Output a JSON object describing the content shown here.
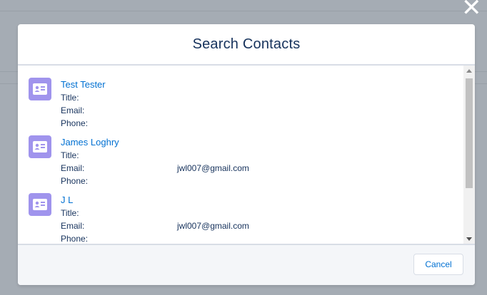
{
  "close_icon_glyph": "✕",
  "modal": {
    "title": "Search Contacts",
    "cancel_label": "Cancel"
  },
  "field_labels": {
    "title": "Title:",
    "email": "Email:",
    "phone": "Phone:"
  },
  "contacts": [
    {
      "name": "Test Tester",
      "title": "",
      "email": "",
      "phone": ""
    },
    {
      "name": "James Loghry",
      "title": "",
      "email": "jwl007@gmail.com",
      "phone": ""
    },
    {
      "name": "J L",
      "title": "",
      "email": "jwl007@gmail.com",
      "phone": ""
    }
  ],
  "colors": {
    "link": "#0070d2",
    "text": "#16325c",
    "avatar_bg": "#a094ed",
    "overlay": "#a5acb4"
  },
  "icons": {
    "close": "close-icon",
    "contact": "contact-card-icon"
  }
}
